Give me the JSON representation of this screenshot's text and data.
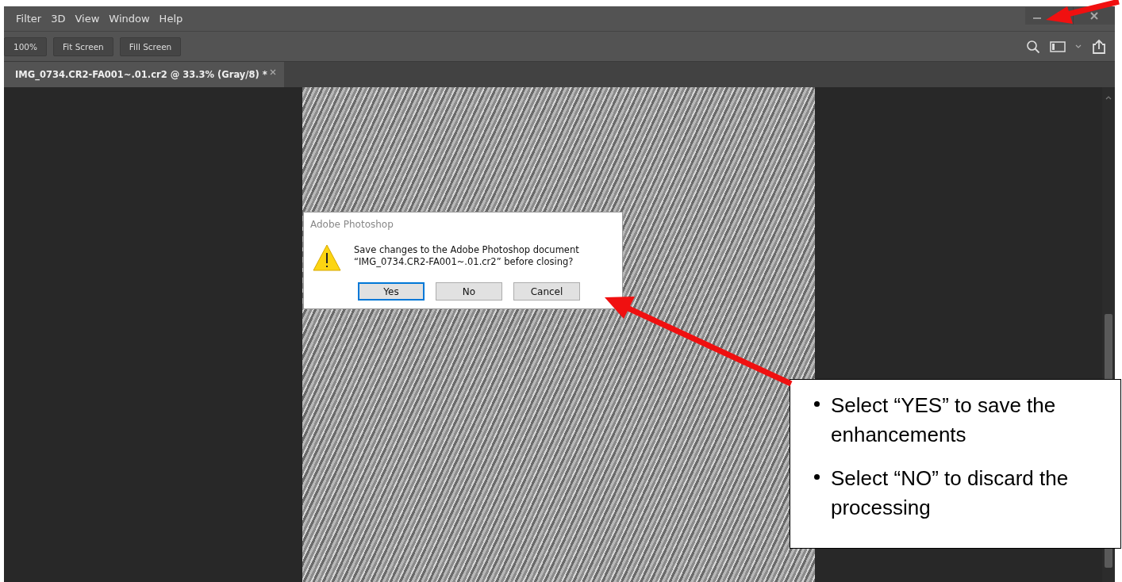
{
  "menu_bar": {
    "items": [
      "Filter",
      "3D",
      "View",
      "Window",
      "Help"
    ]
  },
  "toolbar": {
    "buttons": [
      "100%",
      "Fit Screen",
      "Fill Screen"
    ]
  },
  "document_tabs": [
    {
      "title": "IMG_0734.CR2-FA001~.01.cr2 @ 33.3% (Gray/8) *",
      "selected": true
    }
  ],
  "dialog": {
    "title": "Adobe Photoshop",
    "message_lines": [
      "Save changes to the Adobe Photoshop document",
      "“IMG_0734.CR2-FA001~.01.cr2” before closing?"
    ],
    "buttons": [
      {
        "label": "Yes",
        "default": true
      },
      {
        "label": "No",
        "default": false
      },
      {
        "label": "Cancel",
        "default": false
      }
    ]
  },
  "callout": {
    "bullets": [
      "Select “YES” to save the enhancements",
      "Select “NO” to discard the processing"
    ]
  }
}
